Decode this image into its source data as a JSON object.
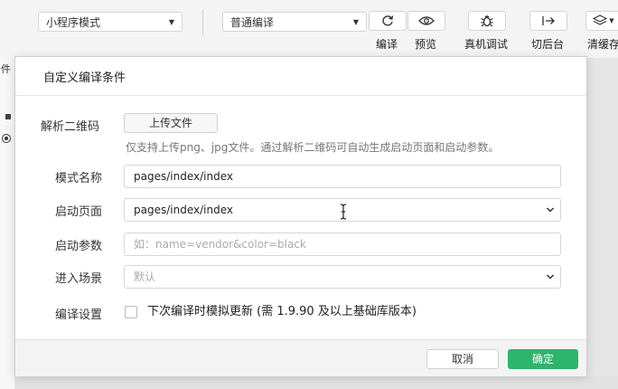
{
  "toolbar": {
    "mode_select": "小程序模式",
    "compile_select": "普通编译",
    "compile_label": "编译",
    "preview_label": "预览",
    "debug_label": "真机调试",
    "background_label": "切后台",
    "clear_label": "清缓存"
  },
  "side": {
    "fragment": "条件"
  },
  "dialog": {
    "title": "自定义编译条件",
    "qr_label": "解析二维码",
    "upload_button": "上传文件",
    "qr_hint": "仅支持上传png、jpg文件。通过解析二维码可自动生成启动页面和启动参数。",
    "mode_name_label": "模式名称",
    "mode_name_value": "pages/index/index",
    "start_page_label": "启动页面",
    "start_page_value": "pages/index/index",
    "start_params_label": "启动参数",
    "start_params_placeholder": "如：name=vendor&color=black",
    "scene_label": "进入场景",
    "scene_value": "默认",
    "compile_settings_label": "编译设置",
    "compile_settings_checkbox": "下次编译时模拟更新 (需 1.9.90 及以上基础库版本)",
    "cancel_button": "取消",
    "ok_button": "确定"
  },
  "colors": {
    "primary": "#2fb46e"
  }
}
